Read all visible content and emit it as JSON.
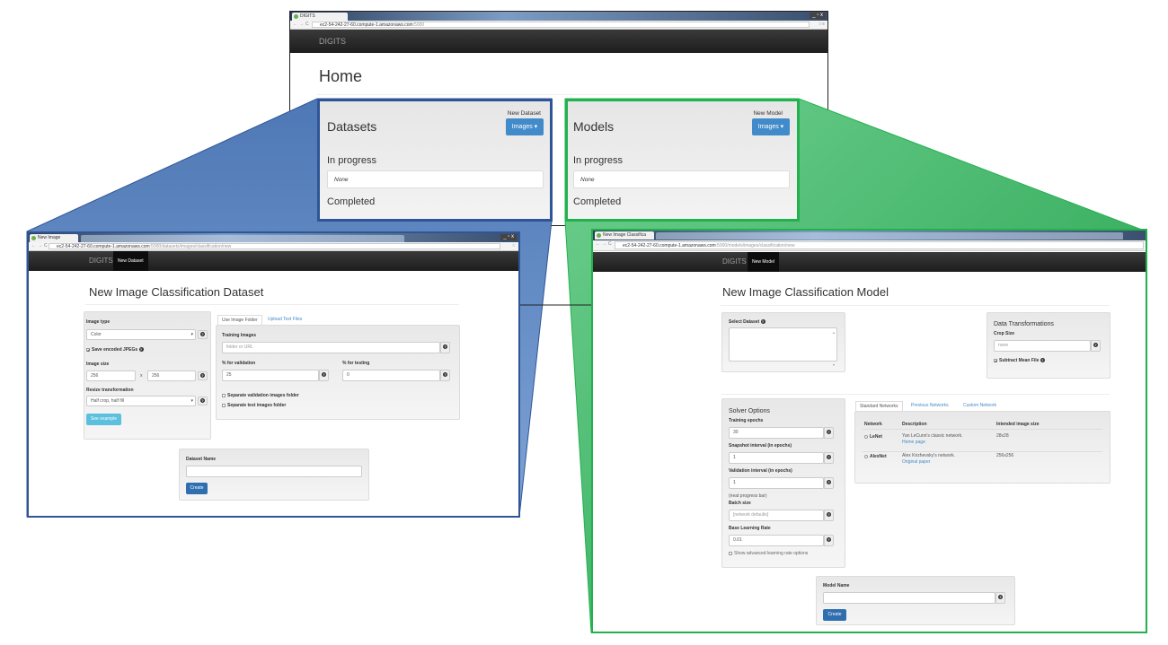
{
  "colors": {
    "dataset_highlight": "#2f5597",
    "model_highlight": "#22b14c",
    "primary_button": "#428bca",
    "info_button": "#5bc0de"
  },
  "home": {
    "tab_title": "DIGITS",
    "url_host": "ec2-54-242-27-60.compute-1.amazonaws.com",
    "url_path": ":5000",
    "brand": "DIGITS",
    "title": "Home",
    "datasets": {
      "title": "Datasets",
      "new_label": "New Dataset",
      "button": "Images ▾",
      "in_progress": "In progress",
      "none": "None",
      "completed": "Completed"
    },
    "models": {
      "title": "Models",
      "new_label": "New Model",
      "button": "Images ▾",
      "in_progress": "In progress",
      "none": "None",
      "completed": "Completed"
    }
  },
  "dataset_page": {
    "tab_title": "New Image Classifica",
    "url_host": "ec2-54-242-27-60.compute-1.amazonaws.com",
    "url_path": ":5000/datasets/images/classification/new",
    "brand": "DIGITS",
    "nav_active": "New Dataset",
    "title": "New Image Classification Dataset",
    "image_type_label": "Image type",
    "image_type_value": "Color",
    "save_jpegs": "Save encoded JPEGs",
    "save_jpegs_checked": true,
    "image_size_label": "Image size",
    "width": "256",
    "x": "x",
    "height": "256",
    "resize_label": "Resize transformation",
    "resize_value": "Half crop, half fill",
    "see_example": "See example",
    "tabs": [
      "Use Image Folder",
      "Upload Text Files"
    ],
    "training_images_label": "Training Images",
    "training_images_placeholder": "folder or URL",
    "validation_label": "% for validation",
    "validation_value": "25",
    "testing_label": "% for testing",
    "testing_value": "0",
    "sep_val": "Separate validation images folder",
    "sep_test": "Separate test images folder",
    "name_label": "Dataset Name",
    "name_value": "",
    "create": "Create"
  },
  "model_page": {
    "tab_title": "New Image Classifica",
    "url_host": "ec2-54-242-27-60.compute-1.amazonaws.com",
    "url_path": ":5000/models/images/classification/new",
    "brand": "DIGITS",
    "nav_active": "New Model",
    "title": "New Image Classification Model",
    "select_dataset": "Select Dataset",
    "transform_title": "Data Transformations",
    "crop_label": "Crop Size",
    "crop_placeholder": "none",
    "subtract_mean": "Subtract Mean File",
    "subtract_mean_checked": true,
    "solver_title": "Solver Options",
    "epochs_label": "Training epochs",
    "epochs_value": "30",
    "snapshot_label": "Snapshot interval (in epochs)",
    "snapshot_value": "1",
    "validation_label": "Validation interval (in epochs)",
    "validation_value": "1",
    "progress_note": "(neat progress bar)",
    "batch_label": "Batch size",
    "batch_placeholder": "[network defaults]",
    "lr_label": "Base Learning Rate",
    "lr_value": "0.01",
    "advanced_lr": "Show advanced learning rate options",
    "net_tabs": [
      "Standard Networks",
      "Previous Networks",
      "Custom Network"
    ],
    "net_headers": [
      "Network",
      "Description",
      "Intended image size"
    ],
    "networks": [
      {
        "name": "LeNet",
        "desc": "Yan LeCunn's classic network.",
        "link": "Home page",
        "size": "28x28"
      },
      {
        "name": "AlexNet",
        "desc": "Alex Krizhevsky's network.",
        "link": "Original paper",
        "size": "256x256"
      }
    ],
    "name_label": "Model Name",
    "name_value": "",
    "create": "Create"
  }
}
